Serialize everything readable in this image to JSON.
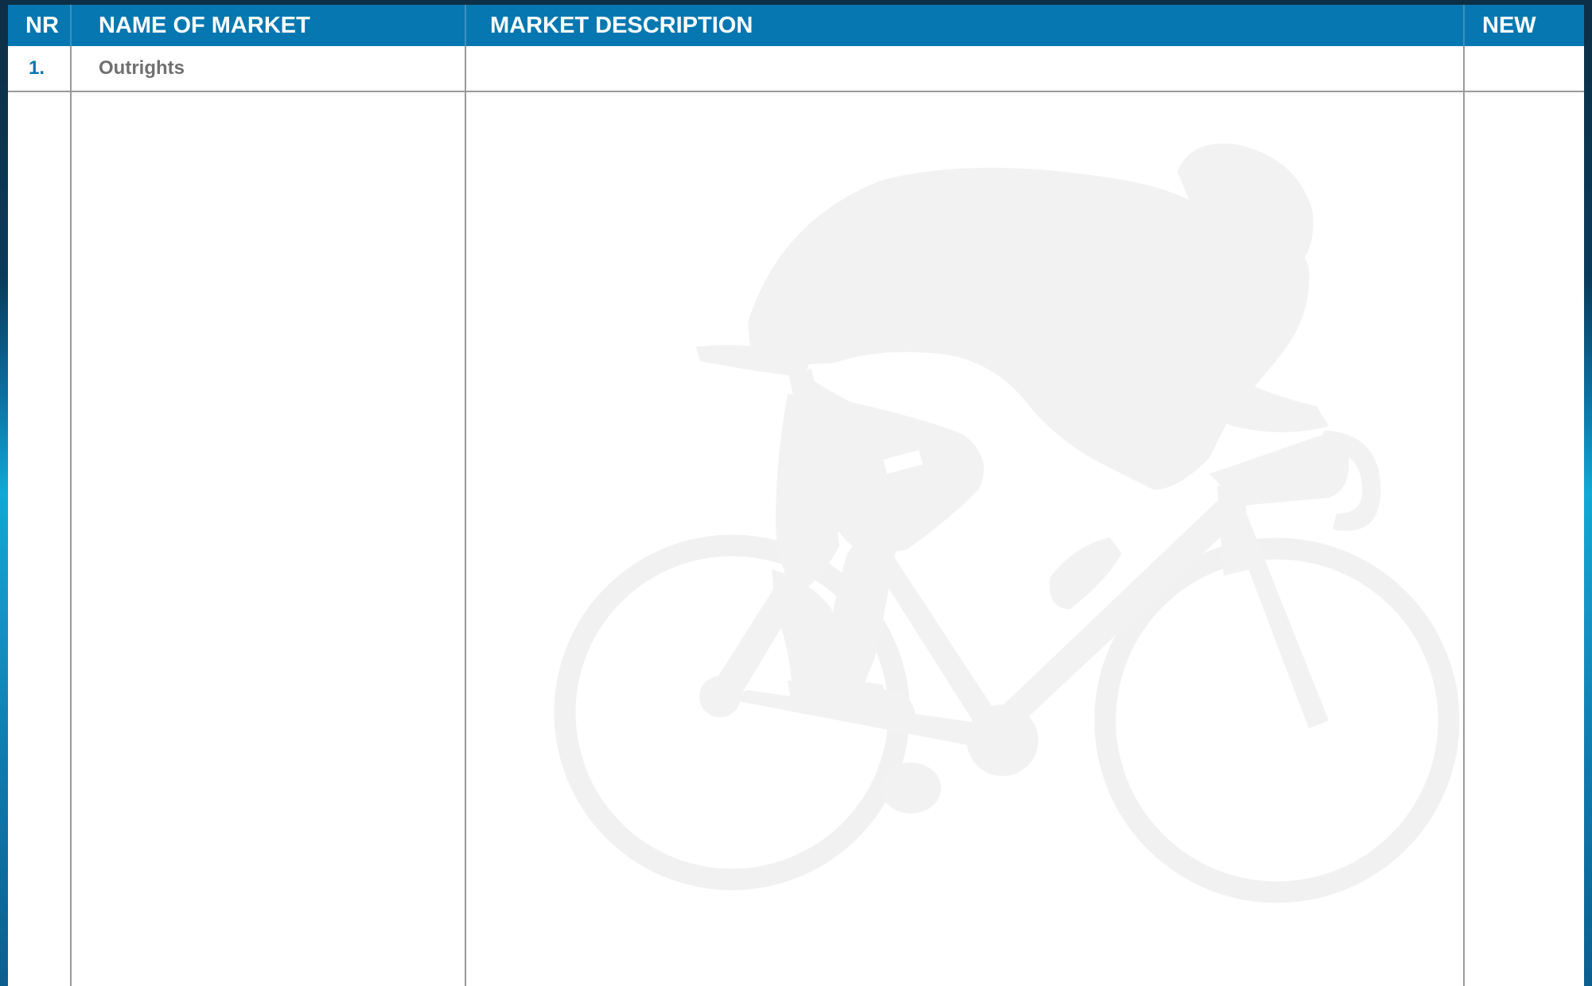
{
  "table": {
    "headers": {
      "nr": "NR",
      "name": "NAME OF MARKET",
      "description": "MARKET DESCRIPTION",
      "new": "NEW"
    },
    "rows": [
      {
        "nr": "1.",
        "name": "Outrights",
        "description": "",
        "new": ""
      }
    ]
  },
  "watermark": {
    "icon": "cyclist-silhouette-icon"
  },
  "colors": {
    "header_background": "#0677b0",
    "header_text": "#ffffff",
    "row_number": "#0677b0",
    "row_text": "#707070",
    "grid_line": "#9a9a9a",
    "watermark": "#f2f2f2"
  }
}
